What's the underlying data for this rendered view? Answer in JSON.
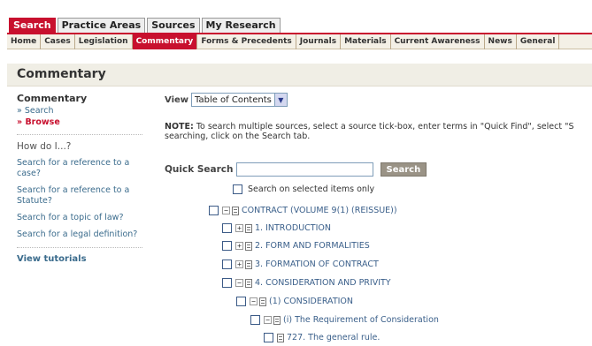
{
  "toptabs": [
    "Search",
    "Practice Areas",
    "Sources",
    "My Research"
  ],
  "subnav": [
    "Home",
    "Cases",
    "Legislation",
    "Commentary",
    "Forms & Precedents",
    "Journals",
    "Materials",
    "Current Awareness",
    "News",
    "General"
  ],
  "header": {
    "title": "Commentary"
  },
  "sidebar": {
    "title": "Commentary",
    "search_link": "» Search",
    "browse_link": "» Browse",
    "howdo": "How do I...?",
    "questions": [
      "Search for a reference to a case?",
      "Search for a reference to a Statute?",
      "Search for a topic of law?",
      "Search for a legal definition?"
    ],
    "tutorials": "View tutorials"
  },
  "view": {
    "label": "View",
    "selected": "Table of Contents"
  },
  "note": {
    "prefix": "NOTE:",
    "line1": " To search multiple sources, select a source tick-box, enter terms in \"Quick Find\", select \"S",
    "line2": "searching, click on the Search tab."
  },
  "quick_search": {
    "label": "Quick Search",
    "value": "",
    "button": "Search",
    "selected_only": "Search on selected items only"
  },
  "tree": [
    {
      "toggle": "−",
      "label": "CONTRACT (VOLUME 9(1) (REISSUE))"
    },
    {
      "toggle": "+",
      "label": "1. INTRODUCTION"
    },
    {
      "toggle": "+",
      "label": "2. FORM AND FORMALITIES"
    },
    {
      "toggle": "+",
      "label": "3. FORMATION OF CONTRACT"
    },
    {
      "toggle": "−",
      "label": "4. CONSIDERATION AND PRIVITY"
    },
    {
      "toggle": "−",
      "label": "(1) CONSIDERATION"
    },
    {
      "toggle": "−",
      "label": "(i) The Requirement of Consideration"
    },
    {
      "toggle": "",
      "label": "727. The general rule."
    }
  ]
}
